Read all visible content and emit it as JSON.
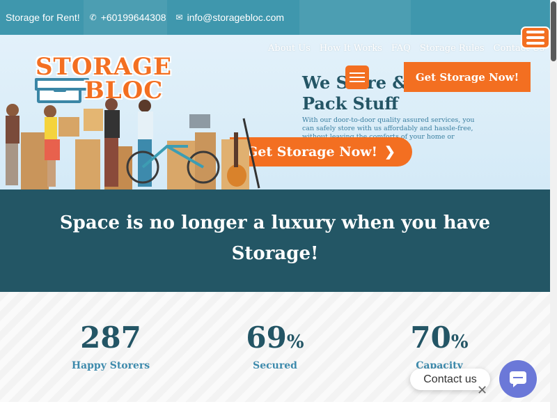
{
  "topbar": {
    "tagline": "Storage for Rent!",
    "phone": "+60199644308",
    "email": "info@storagebloc.com",
    "phone_icon": "phone-icon",
    "email_icon": "mail-icon"
  },
  "nav": {
    "items": [
      "About Us",
      "How It Works",
      "FAQ",
      "Storage Rules",
      "Contact Us"
    ]
  },
  "logo": {
    "line1": "STORAGE",
    "line2": "BLOC"
  },
  "hero": {
    "title_line1": "We Store &",
    "title_line2": "Pack Stuff",
    "text": "With our door-to-door quality assured services, you can safely store with us affordably and hassle-free, without leaving the comforts of your home or office.",
    "cta_top": "Get Storage Now!",
    "cta_main": "Get Storage Now!",
    "chevron_icon": "chevron-right-icon"
  },
  "band": {
    "line1": "Space is no longer a luxury when you have",
    "line2": "Storage!"
  },
  "stats": [
    {
      "value": "287",
      "suffix": "",
      "label": "Happy Storers"
    },
    {
      "value": "69",
      "suffix": "%",
      "label": "Secured"
    },
    {
      "value": "70",
      "suffix": "%",
      "label": "Capacity"
    }
  ],
  "contact": {
    "label": "Contact us",
    "icon": "chat-icon"
  },
  "colors": {
    "accent": "#f36f21",
    "dark": "#235565",
    "topbar": "#3f97ad",
    "widget": "#6b78d8"
  }
}
